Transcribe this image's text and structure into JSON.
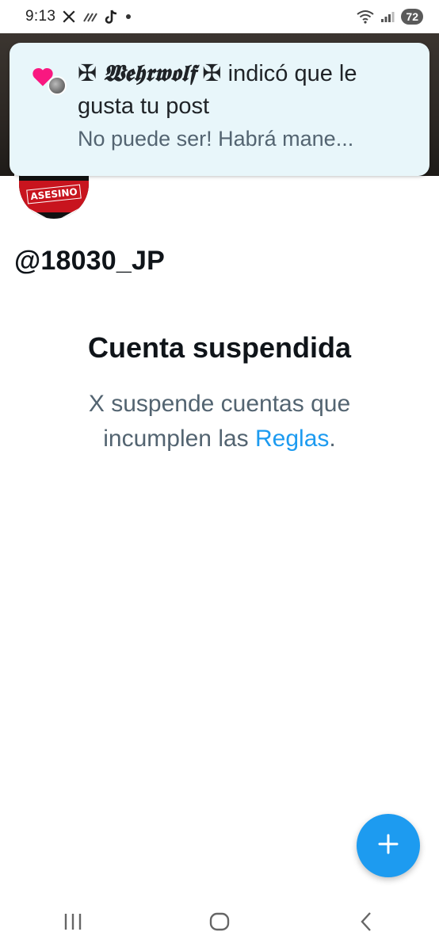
{
  "status_bar": {
    "time": "9:13",
    "battery": "72",
    "icons": [
      "x-logo-icon",
      "signal-strength-icon",
      "tiktok-icon",
      "dot-icon",
      "wifi-icon",
      "cell-signal-icon",
      "battery-icon"
    ]
  },
  "notification": {
    "cross_left": "✠",
    "user_name": "𝖂𝖊𝖍𝖗𝖜𝖔𝖑𝖋",
    "cross_right": "✠",
    "action_text": "indicó que le gusta tu post",
    "body_preview": "No puede ser! Habrá mane...",
    "icon": "heart-icon",
    "heart_color": "#f91880"
  },
  "avatar": {
    "label": "ASESINO"
  },
  "profile": {
    "handle": "@18030_JP"
  },
  "suspended": {
    "title": "Cuenta suspendida",
    "desc_before": "X suspende cuentas que incumplen las ",
    "rules_link": "Reglas",
    "desc_after": "."
  },
  "fab": {
    "icon": "plus-icon"
  },
  "nav": {
    "items": [
      "recent-apps-icon",
      "home-icon",
      "back-icon"
    ]
  },
  "colors": {
    "accent": "#1d9bf0",
    "secondary_text": "#536471",
    "primary_text": "#0f1419",
    "notification_bg": "#e8f6fa"
  }
}
